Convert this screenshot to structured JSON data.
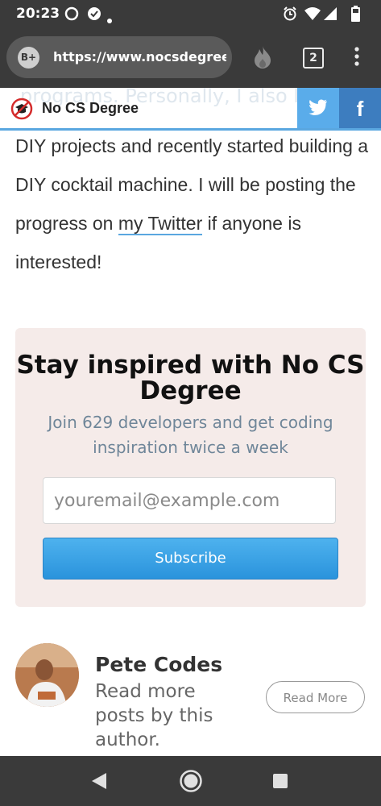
{
  "status_bar": {
    "time": "20:23",
    "icons": [
      "chat-bubble-icon",
      "notification-icon",
      "dot-icon",
      "alarm-icon",
      "wifi-icon",
      "signal-icon",
      "battery-icon"
    ]
  },
  "browser": {
    "site_badge": "B+",
    "url": "https://www.nocsdegree.com",
    "tab_count": "2",
    "icons": [
      "flame-icon",
      "more-vert-icon"
    ]
  },
  "site_header": {
    "brand": "No CS Degree",
    "scrolled_text": "programs. Personally, I also love",
    "facebook_glyph": "f",
    "colors": {
      "accent": "#5aa7e0",
      "twitter": "#5aacea",
      "facebook": "#3d7dbf"
    }
  },
  "article": {
    "text_before_link": "DIY projects and recently started building a DIY cocktail machine. I will be posting the progress on ",
    "link_text": "my Twitter",
    "text_after_link": " if anyone is interested!"
  },
  "newsletter": {
    "title": "Stay inspired with No CS Degree",
    "subtitle": "Join 629 developers and get coding inspiration twice a week",
    "email_placeholder": "youremail@example.com",
    "subscribe_label": "Subscribe",
    "colors": {
      "background": "#f5ebe9",
      "button": "#3aa1e6"
    }
  },
  "author": {
    "name": "Pete Codes",
    "description": "Read more posts by this author.",
    "read_more_label": "Read More"
  },
  "nav_bar": {
    "icons": [
      "back-icon",
      "home-icon",
      "recents-icon"
    ]
  }
}
